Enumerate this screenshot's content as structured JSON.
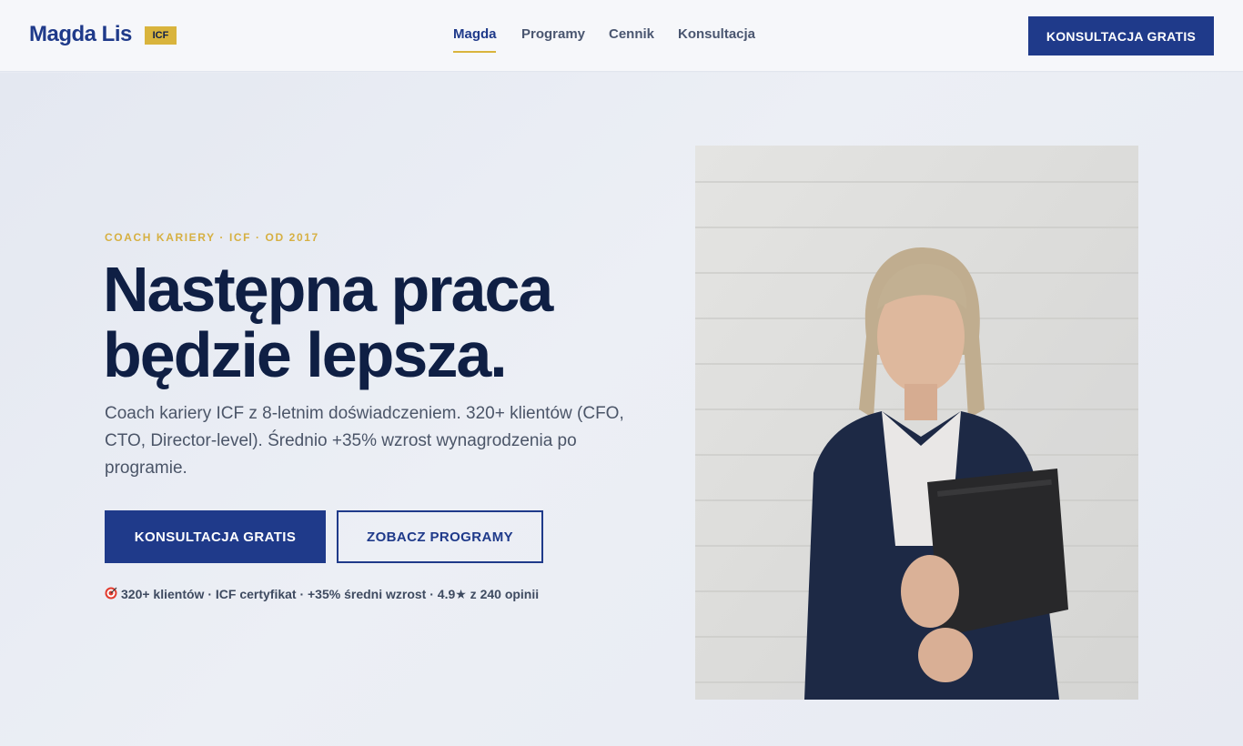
{
  "header": {
    "logo": "Magda Lis",
    "badge": "ICF",
    "nav": [
      {
        "label": "Magda"
      },
      {
        "label": "Programy"
      },
      {
        "label": "Cennik"
      },
      {
        "label": "Konsultacja"
      }
    ],
    "cta_label": "KONSULTACJA GRATIS"
  },
  "hero": {
    "eyebrow": "COACH KARIERY · ICF · OD 2017",
    "headline_line1": "Następna praca",
    "headline_line2": "będzie lepsza.",
    "lead": "Coach kariery ICF z 8-letnim doświadczeniem. 320+ klientów (CFO, CTO, Director-level). Średnio +35% wzrost wynagrodzenia po programie.",
    "primary_button": "KONSULTACJA GRATIS",
    "secondary_button": "ZOBACZ PROGRAMY",
    "trust_line": "320+ klientów · ICF certyfikat · +35% średni wzrost · 4.9★ z 240 opinii",
    "trust_icon": "target-icon"
  },
  "colors": {
    "brand": "#1f3a8a",
    "accent": "#d9b43c",
    "heading": "#0f1f44"
  }
}
